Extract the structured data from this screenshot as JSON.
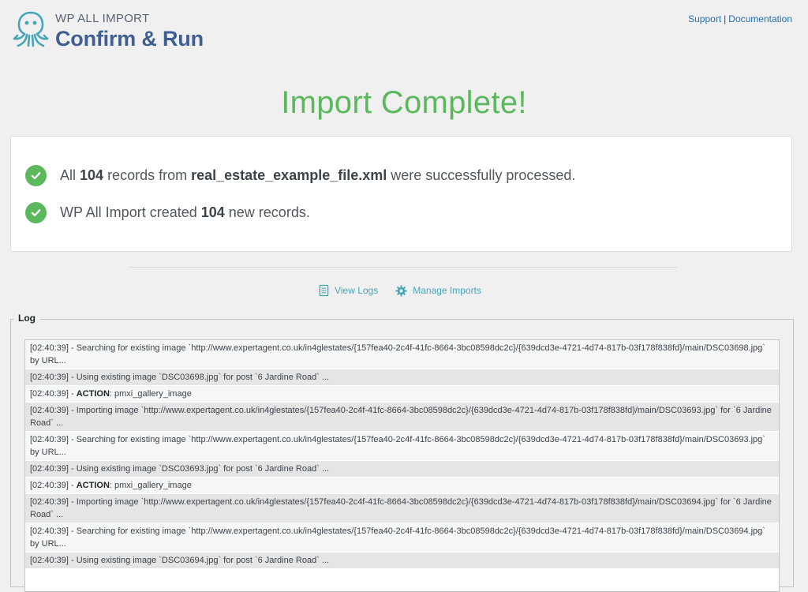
{
  "header": {
    "brand_small": "WP ALL IMPORT",
    "brand_big": "Confirm & Run",
    "support_label": "Support",
    "separator": "|",
    "documentation_label": "Documentation"
  },
  "status": {
    "title": "Import Complete!"
  },
  "summary": {
    "line1": {
      "prefix": "All ",
      "count": "104",
      "middle": " records from ",
      "file": "real_estate_example_file.xml",
      "suffix": " were successfully processed."
    },
    "line2": {
      "prefix": "WP All Import created ",
      "count": "104",
      "suffix": " new records."
    }
  },
  "actions": {
    "view_logs": "View Logs",
    "manage_imports": "Manage Imports"
  },
  "log": {
    "legend": "Log",
    "rows": [
      {
        "pre": "[02:40:39] - Searching for existing image `http://www.expertagent.co.uk/in4glestates/{157fea40-2c4f-41fc-8664-3bc08598dc2c}/{639dcd3e-4721-4d74-817b-03f178f838fd}/main/DSC03698.jpg` by URL...",
        "bold": "",
        "post": ""
      },
      {
        "pre": "[02:40:39] - Using existing image `DSC03698.jpg` for post `6 Jardine Road` ...",
        "bold": "",
        "post": ""
      },
      {
        "pre": "[02:40:39] - ",
        "bold": "ACTION",
        "post": ": pmxi_gallery_image"
      },
      {
        "pre": "[02:40:39] - Importing image `http://www.expertagent.co.uk/in4glestates/{157fea40-2c4f-41fc-8664-3bc08598dc2c}/{639dcd3e-4721-4d74-817b-03f178f838fd}/main/DSC03693.jpg` for `6 Jardine Road` ...",
        "bold": "",
        "post": ""
      },
      {
        "pre": "[02:40:39] - Searching for existing image `http://www.expertagent.co.uk/in4glestates/{157fea40-2c4f-41fc-8664-3bc08598dc2c}/{639dcd3e-4721-4d74-817b-03f178f838fd}/main/DSC03693.jpg` by URL...",
        "bold": "",
        "post": ""
      },
      {
        "pre": "[02:40:39] - Using existing image `DSC03693.jpg` for post `6 Jardine Road` ...",
        "bold": "",
        "post": ""
      },
      {
        "pre": "[02:40:39] - ",
        "bold": "ACTION",
        "post": ": pmxi_gallery_image"
      },
      {
        "pre": "[02:40:39] - Importing image `http://www.expertagent.co.uk/in4glestates/{157fea40-2c4f-41fc-8664-3bc08598dc2c}/{639dcd3e-4721-4d74-817b-03f178f838fd}/main/DSC03694.jpg` for `6 Jardine Road` ...",
        "bold": "",
        "post": ""
      },
      {
        "pre": "[02:40:39] - Searching for existing image `http://www.expertagent.co.uk/in4glestates/{157fea40-2c4f-41fc-8664-3bc08598dc2c}/{639dcd3e-4721-4d74-817b-03f178f838fd}/main/DSC03694.jpg` by URL...",
        "bold": "",
        "post": ""
      },
      {
        "pre": "[02:40:39] - Using existing image `DSC03694.jpg` for post `6 Jardine Road` ...",
        "bold": "",
        "post": ""
      }
    ]
  },
  "colors": {
    "success_green": "#5cb85c",
    "brand_blue": "#3f5f93",
    "link_blue": "#2271b1",
    "teal_action": "#46a6b8"
  }
}
